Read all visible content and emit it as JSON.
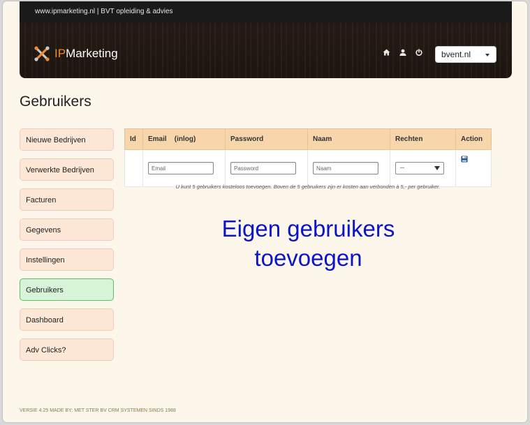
{
  "header": {
    "top_text": "www.ipmarketing.nl | BVT opleiding & advies",
    "logo": {
      "prefix": "IP",
      "suffix": "Marketing",
      "icon": "cross-tools-icon",
      "prefix_color": "#f08a2a"
    },
    "icons": [
      "home-icon",
      "user-icon",
      "power-icon"
    ],
    "domain_select": {
      "value": "bvent.nl"
    }
  },
  "page": {
    "title": "Gebruikers"
  },
  "sidebar": {
    "items": [
      {
        "label": "Nieuwe Bedrijven",
        "active": false
      },
      {
        "label": "Verwerkte Bedrijven",
        "active": false
      },
      {
        "label": "Facturen",
        "active": false
      },
      {
        "label": "Gegevens",
        "active": false
      },
      {
        "label": "Instellingen",
        "active": false
      },
      {
        "label": "Gebruikers",
        "active": true
      },
      {
        "label": "Dashboard",
        "active": false
      },
      {
        "label": "Adv Clicks?",
        "active": false
      }
    ]
  },
  "table": {
    "headers": {
      "id": "Id",
      "email": "Email    (inlog)",
      "password": "Password",
      "name": "Naam",
      "rights": "Rechten",
      "action": "Action"
    },
    "new_row": {
      "email_placeholder": "Email",
      "password_placeholder": "Password",
      "name_placeholder": "Naam",
      "rights_value": "--",
      "save_icon": "floppy-disk-icon"
    }
  },
  "note": "U kunt 5 gebruikers kosteloos toevoegen. Boven de 5 gebruikers zijn er kosten aan verbonden à 5,- per gebruiker.",
  "caption": {
    "line1": "Eigen gebruikers",
    "line2": "toevoegen",
    "color": "#0a14c8"
  },
  "footer": "VERSIE 4.25 MADE BY: MET STER BV CRM SYSTEMEN SINDS 1988",
  "colors": {
    "nav_bg": "#fde7d6",
    "nav_active_bg": "#d7f3d8",
    "nav_active_border": "#57c35b",
    "table_header_bg": "#f8d6ac"
  }
}
